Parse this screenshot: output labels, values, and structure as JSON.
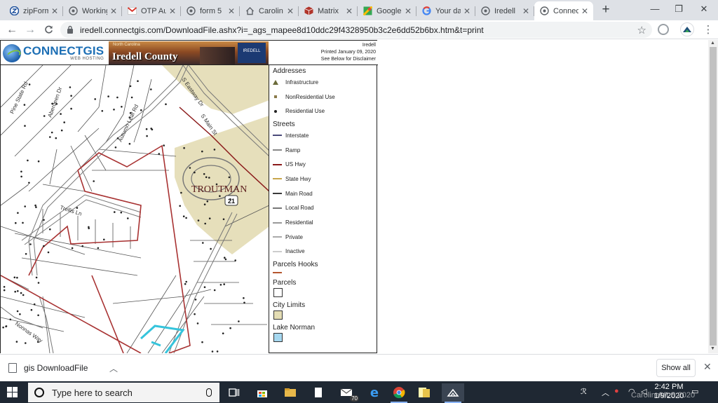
{
  "browser": {
    "tabs": [
      {
        "label": "zipForm",
        "icon": "zipform-icon"
      },
      {
        "label": "Working",
        "icon": "chrome-page-icon"
      },
      {
        "label": "OTP Au",
        "icon": "gmail-icon"
      },
      {
        "label": "form 5",
        "icon": "chrome-page-icon"
      },
      {
        "label": "Carolin",
        "icon": "home-icon"
      },
      {
        "label": "Matrix",
        "icon": "matrix-icon"
      },
      {
        "label": "Google",
        "icon": "google-maps-icon"
      },
      {
        "label": "Your da",
        "icon": "google-icon"
      },
      {
        "label": "Iredell",
        "icon": "chrome-page-icon"
      },
      {
        "label": "Connec",
        "icon": "chrome-page-icon"
      }
    ],
    "active_tab": 9,
    "url": "iredell.connectgis.com/DownloadFile.ashx?i=_ags_mapee8d10ddc29f4328950b3c2e6dd52b6bx.htm&t=print",
    "window_controls": {
      "minimize": "—",
      "restore": "❐",
      "close": "✕"
    }
  },
  "map_header": {
    "logo_text_main": "CONNECTGIS",
    "logo_text_sub": "WEB HOSTING",
    "banner_state": "North Carolina",
    "banner_county": "Iredell County",
    "seal_text": "IREDELL",
    "print_lines": [
      "Iredell",
      "Printed January 09, 2020",
      "See Below for Disclaimer"
    ]
  },
  "map": {
    "road_labels": {
      "pine_state": "Pine State Rd",
      "aberdeen": "Aberdeen Dr",
      "autumn_leaf": "Autumn Leaf Rd",
      "eastway": "S Eastway Dr",
      "main": "S Main St",
      "trellis": "Trellis Ln",
      "nonnas": "Nonnas Way"
    },
    "highway_shield": "21",
    "town_label": "TROUTMAN"
  },
  "legend": {
    "sections": [
      {
        "title": "Addresses",
        "items": [
          {
            "label": "Infrastructure",
            "symbol": "triangle",
            "color": "#6b6b3a"
          },
          {
            "label": "NonResidential Use",
            "symbol": "square",
            "color": "#8a7a4a"
          },
          {
            "label": "Residential Use",
            "symbol": "dot",
            "color": "#222222"
          }
        ]
      },
      {
        "title": "Streets",
        "items": [
          {
            "label": "Interstate",
            "symbol": "line",
            "color": "#4a4a7a"
          },
          {
            "label": "Ramp",
            "symbol": "line",
            "color": "#888888"
          },
          {
            "label": "US Hwy",
            "symbol": "line",
            "color": "#8b1a1a"
          },
          {
            "label": "State Hwy",
            "symbol": "line",
            "color": "#c8a64b"
          },
          {
            "label": "Main Road",
            "symbol": "line",
            "color": "#3a3a3a"
          },
          {
            "label": "Local Road",
            "symbol": "line",
            "color": "#777777"
          },
          {
            "label": "Residential",
            "symbol": "line",
            "color": "#999999"
          },
          {
            "label": "Private",
            "symbol": "line",
            "color": "#aaaaaa"
          },
          {
            "label": "Inactive",
            "symbol": "line",
            "color": "#cccccc"
          }
        ]
      },
      {
        "title": "Parcels Hooks",
        "items": [
          {
            "label": "",
            "symbol": "line",
            "color": "#b5562e"
          }
        ]
      },
      {
        "title": "Parcels",
        "items": [
          {
            "label": "",
            "symbol": "box",
            "color": "#ffffff"
          }
        ]
      },
      {
        "title": "City Limits",
        "items": [
          {
            "label": "",
            "symbol": "box",
            "color": "#e4ddb4"
          }
        ]
      },
      {
        "title": "Lake Norman",
        "items": [
          {
            "label": "",
            "symbol": "box",
            "color": "#a6d8f0"
          }
        ]
      }
    ]
  },
  "downloads": {
    "file_name": "gis DownloadFile",
    "show_all_label": "Show all",
    "close_label": "✕"
  },
  "taskbar": {
    "search_placeholder": "Type here to search",
    "mail_badge": "70",
    "time": "2:42 PM",
    "date": "1/9/2020",
    "watermark": "CarolinaMLS 2020"
  }
}
